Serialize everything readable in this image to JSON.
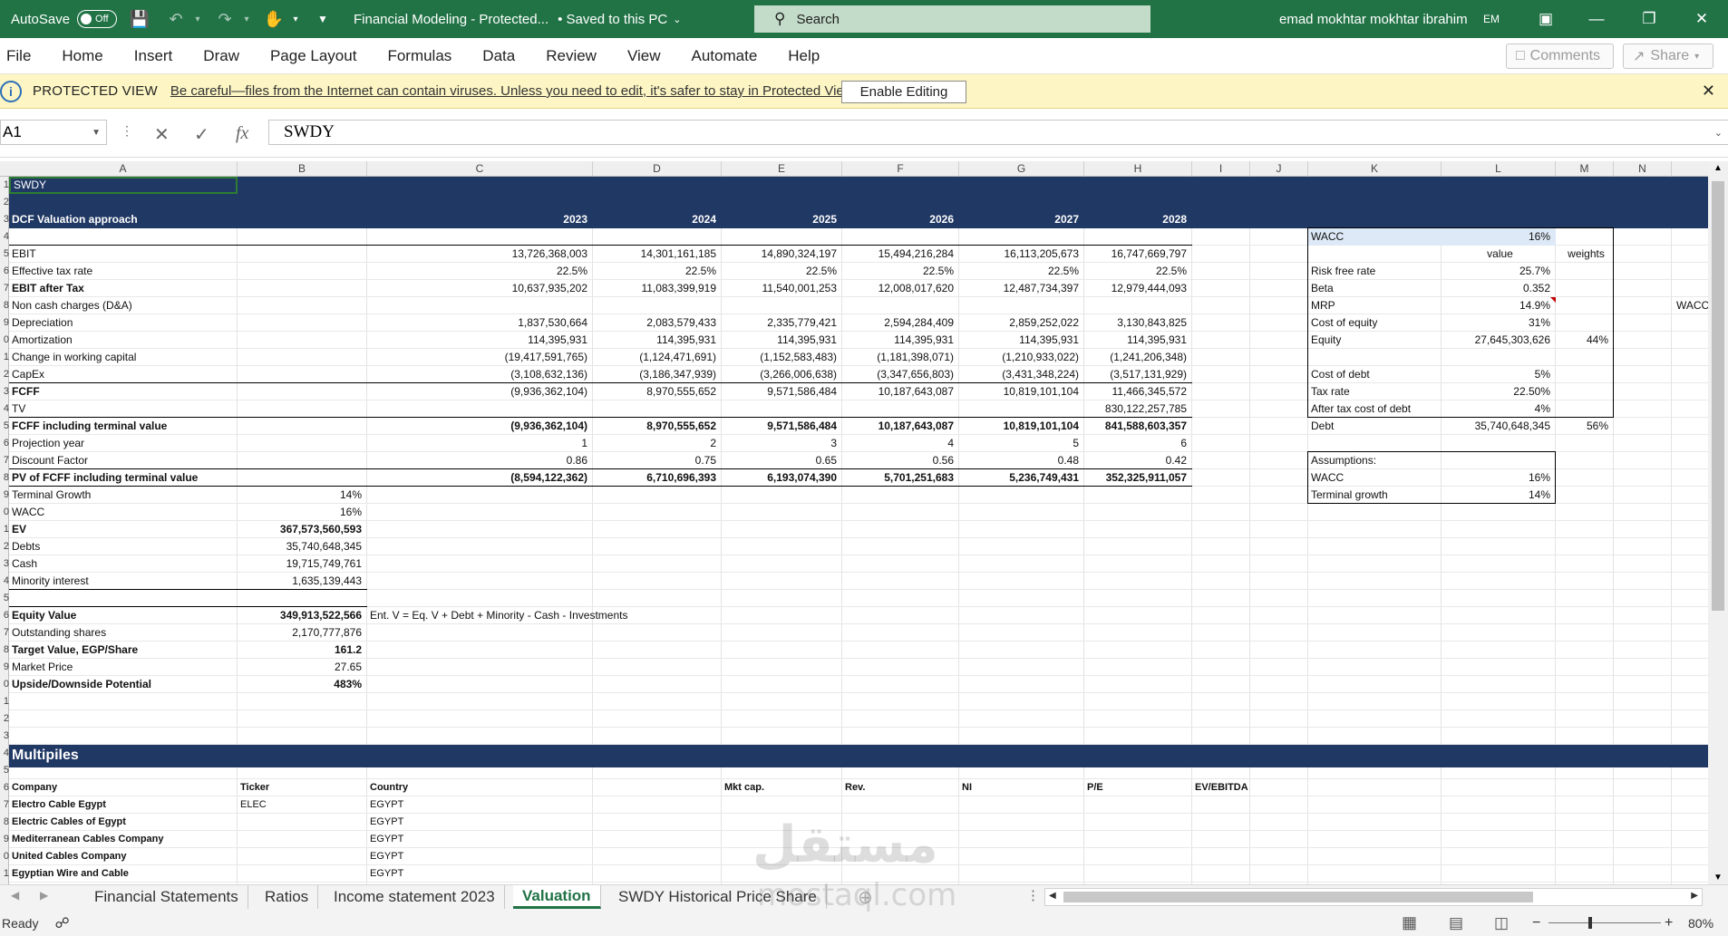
{
  "titlebar": {
    "autosave_label": "AutoSave",
    "autosave_state": "Off",
    "doc_title": "Financial Modeling  -  Protected...",
    "save_status": "• Saved to this PC",
    "search_placeholder": "Search",
    "user_name": "emad mokhtar mokhtar ibrahim",
    "user_initials": "EM"
  },
  "ribbon": {
    "tabs": [
      "File",
      "Home",
      "Insert",
      "Draw",
      "Page Layout",
      "Formulas",
      "Data",
      "Review",
      "View",
      "Automate",
      "Help"
    ],
    "comments_label": "Comments",
    "share_label": "Share"
  },
  "protected_view": {
    "label": "PROTECTED VIEW",
    "message": "Be careful—files from the Internet can contain viruses. Unless you need to edit, it's safer to stay in Protected View.",
    "button": "Enable Editing"
  },
  "formula_bar": {
    "name_box": "A1",
    "formula": "SWDY"
  },
  "columns": [
    "A",
    "B",
    "C",
    "D",
    "E",
    "F",
    "G",
    "H",
    "I",
    "J",
    "K",
    "L",
    "M",
    "N"
  ],
  "rows": [
    "1",
    "2",
    "3",
    "4",
    "5",
    "6",
    "7",
    "8",
    "9",
    "0",
    "1",
    "2",
    "3",
    "4",
    "5",
    "6",
    "7",
    "8",
    "9",
    "0",
    "1",
    "2",
    "3",
    "4",
    "5",
    "6",
    "7",
    "8",
    "9",
    "0",
    "1",
    "2",
    "3",
    "4",
    "5",
    "6",
    "7",
    "8",
    "9",
    "0",
    "1"
  ],
  "sheet": {
    "a1": "SWDY",
    "dcf_title": "DCF  Valuation approach",
    "years": [
      "2023",
      "2024",
      "2025",
      "2026",
      "2027",
      "2028"
    ],
    "dcf_rows": [
      {
        "label": "EBIT",
        "bold": false,
        "vals": [
          "13,726,368,003",
          "14,301,161,185",
          "14,890,324,197",
          "15,494,216,284",
          "16,113,205,673",
          "16,747,669,797"
        ]
      },
      {
        "label": "Effective tax rate",
        "bold": false,
        "vals": [
          "22.5%",
          "22.5%",
          "22.5%",
          "22.5%",
          "22.5%",
          "22.5%"
        ]
      },
      {
        "label": "EBIT after Tax",
        "bold": true,
        "vals": [
          "10,637,935,202",
          "11,083,399,919",
          "11,540,001,253",
          "12,008,017,620",
          "12,487,734,397",
          "12,979,444,093"
        ],
        "vbold": false
      },
      {
        "label": "Non cash charges (D&A)",
        "bold": false,
        "vals": [
          "",
          "",
          "",
          "",
          "",
          ""
        ]
      },
      {
        "label": "Depreciation",
        "bold": false,
        "vals": [
          "1,837,530,664",
          "2,083,579,433",
          "2,335,779,421",
          "2,594,284,409",
          "2,859,252,022",
          "3,130,843,825"
        ]
      },
      {
        "label": "Amortization",
        "bold": false,
        "vals": [
          "114,395,931",
          "114,395,931",
          "114,395,931",
          "114,395,931",
          "114,395,931",
          "114,395,931"
        ]
      },
      {
        "label": "Change in working capital",
        "bold": false,
        "vals": [
          "(19,417,591,765)",
          "(1,124,471,691)",
          "(1,152,583,483)",
          "(1,181,398,071)",
          "(1,210,933,022)",
          "(1,241,206,348)"
        ]
      },
      {
        "label": "CapEx",
        "bold": false,
        "vals": [
          "(3,108,632,136)",
          "(3,186,347,939)",
          "(3,266,006,638)",
          "(3,347,656,803)",
          "(3,431,348,224)",
          "(3,517,131,929)"
        ]
      },
      {
        "label": "FCFF",
        "bold": true,
        "vals": [
          "(9,936,362,104)",
          "8,970,555,652",
          "9,571,586,484",
          "10,187,643,087",
          "10,819,101,104",
          "11,466,345,572"
        ],
        "vbold": false
      },
      {
        "label": "TV",
        "bold": false,
        "vals": [
          "",
          "",
          "",
          "",
          "",
          "830,122,257,785"
        ]
      },
      {
        "label": "FCFF including terminal value",
        "bold": true,
        "vals": [
          "(9,936,362,104)",
          "8,970,555,652",
          "9,571,586,484",
          "10,187,643,087",
          "10,819,101,104",
          "841,588,603,357"
        ],
        "vbold": true
      },
      {
        "label": "Projection year",
        "bold": false,
        "vals": [
          "1",
          "2",
          "3",
          "4",
          "5",
          "6"
        ]
      },
      {
        "label": "Discount Factor",
        "bold": false,
        "vals": [
          "0.86",
          "0.75",
          "0.65",
          "0.56",
          "0.48",
          "0.42"
        ]
      },
      {
        "label": "PV of FCFF including terminal value",
        "bold": true,
        "vals": [
          "(8,594,122,362)",
          "6,710,696,393",
          "6,193,074,390",
          "5,701,251,683",
          "5,236,749,431",
          "352,325,911,057"
        ],
        "vbold": true
      }
    ],
    "summary_rows": [
      {
        "label": "Terminal Growth",
        "bold": false,
        "value": "14%",
        "vbold": false
      },
      {
        "label": "WACC",
        "bold": false,
        "value": "16%",
        "vbold": false
      },
      {
        "label": "EV",
        "bold": true,
        "value": "367,573,560,593",
        "vbold": true
      },
      {
        "label": "Debts",
        "bold": false,
        "value": "35,740,648,345",
        "vbold": false
      },
      {
        "label": "Cash",
        "bold": false,
        "value": "19,715,749,761",
        "vbold": false
      },
      {
        "label": "Minority interest",
        "bold": false,
        "value": "1,635,139,443",
        "vbold": false
      }
    ],
    "equity_rows": [
      {
        "label": "Equity Value",
        "bold": true,
        "value": "349,913,522,566",
        "vbold": true
      },
      {
        "label": "Outstanding shares",
        "bold": false,
        "value": "2,170,777,876",
        "vbold": false
      },
      {
        "label": "Target Value, EGP/Share",
        "bold": true,
        "value": "161.2",
        "vbold": true
      },
      {
        "label": "Market Price",
        "bold": false,
        "value": "27.65",
        "vbold": false
      },
      {
        "label": "Upside/Downside Potential",
        "bold": true,
        "value": "483%",
        "vbold": true
      }
    ],
    "ev_note": "Ent. V = Eq. V + Debt + Minority - Cash - Investments",
    "wacc_box": {
      "title": "WACC",
      "title_value": "16%",
      "col_value": "value",
      "col_weights": "weights",
      "rows": [
        {
          "label": "Risk free rate",
          "value": "25.7%",
          "weight": ""
        },
        {
          "label": "Beta",
          "value": "0.352",
          "weight": ""
        },
        {
          "label": "MRP",
          "value": "14.9%",
          "weight": ""
        },
        {
          "label": "Cost of equity",
          "value": "31%",
          "weight": ""
        },
        {
          "label": "Equity",
          "value": "27,645,303,626",
          "weight": "44%"
        },
        {
          "label": "",
          "value": "",
          "weight": ""
        },
        {
          "label": "Cost of debt",
          "value": "5%",
          "weight": ""
        },
        {
          "label": "Tax rate",
          "value": "22.50%",
          "weight": ""
        },
        {
          "label": "After tax cost of debt",
          "value": "4%",
          "weight": ""
        },
        {
          "label": "Debt",
          "value": "35,740,648,345",
          "weight": "56%"
        }
      ]
    },
    "n_col_text": "WACC",
    "assumptions": {
      "title": "Assumptions:",
      "rows": [
        {
          "label": "WACC",
          "value": "16%"
        },
        {
          "label": "Terminal growth",
          "value": "14%"
        }
      ]
    },
    "multiples_title": "Multipiles",
    "multiples_headers": [
      "Company",
      "Ticker",
      "Country",
      "Mkt cap.",
      "Rev.",
      "NI",
      "P/E",
      "EV/EBITDA"
    ],
    "multiples_rows": [
      {
        "company": "Electro Cable Egypt",
        "ticker": "ELEC",
        "country": "EGYPT"
      },
      {
        "company": "Electric Cables of Egypt",
        "ticker": "",
        "country": "EGYPT"
      },
      {
        "company": "Mediterranean Cables Company",
        "ticker": "",
        "country": "EGYPT"
      },
      {
        "company": "United Cables Company",
        "ticker": "",
        "country": "EGYPT"
      },
      {
        "company": "Egyptian Wire and Cable",
        "ticker": "",
        "country": "EGYPT"
      }
    ]
  },
  "sheet_tabs": [
    "Financial Statements",
    "Ratios",
    "Income statement 2023",
    "Valuation",
    "SWDY Historical Price Share"
  ],
  "active_tab": "Valuation",
  "status": {
    "ready": "Ready",
    "zoom": "80%"
  },
  "watermark": {
    "arabic": "مستقل",
    "latin": "mostaql.com"
  }
}
